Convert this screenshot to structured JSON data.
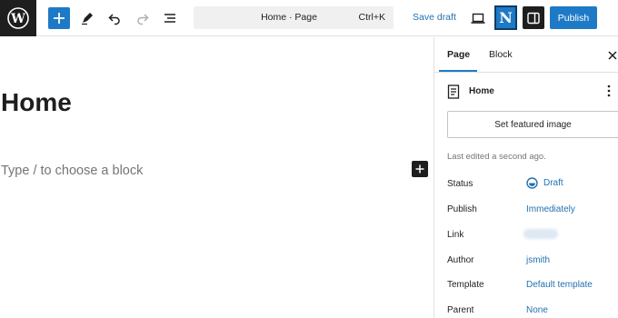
{
  "toolbar": {
    "command_title": "Home · Page",
    "command_shortcut": "Ctrl+K",
    "save_draft_label": "Save draft",
    "n_logo_letter": "N",
    "publish_label": "Publish",
    "accent_color": "#1e7ac6",
    "icons": [
      "wordpress-logo",
      "plus-icon",
      "pen-icon",
      "undo-icon",
      "redo-icon",
      "list-view-icon",
      "desktop-view-icon",
      "settings-panel-icon"
    ]
  },
  "editor": {
    "page_title": "Home",
    "block_placeholder": "Type / to choose a block"
  },
  "sidebar": {
    "tabs": [
      {
        "label": "Page",
        "active": true
      },
      {
        "label": "Block",
        "active": false
      }
    ],
    "document_title": "Home",
    "featured_image_label": "Set featured image",
    "last_edited": "Last edited a second ago.",
    "meta": [
      {
        "label": "Status",
        "value": "Draft"
      },
      {
        "label": "Publish",
        "value": "Immediately"
      },
      {
        "label": "Link",
        "value": ""
      },
      {
        "label": "Author",
        "value": "jsmith"
      },
      {
        "label": "Template",
        "value": "Default template"
      },
      {
        "label": "Parent",
        "value": "None"
      }
    ]
  }
}
